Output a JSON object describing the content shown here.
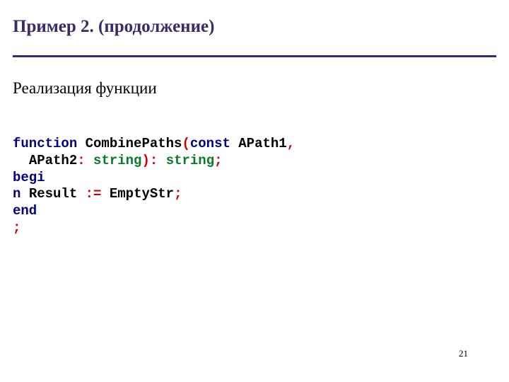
{
  "title": "Пример 2. (продолжение)",
  "subtitle": "Реализация функции",
  "code": {
    "l1": {
      "kw1": "function",
      "sp1": " ",
      "name": "CombinePaths",
      "p1": "(",
      "kw2": "const",
      "sp2": " ",
      "arg1": "APath1",
      "c1": ","
    },
    "l2": {
      "indent": "  ",
      "arg2": "APath2",
      "colon": ": ",
      "t1": "string",
      "p2": ")",
      "colon2": ": ",
      "t2": "string",
      "semi": ";"
    },
    "l3": {
      "kw": "begi"
    },
    "l4": {
      "kw": "n",
      "sp": " ",
      "res": "Result",
      "sp2": " ",
      "assign": ":=",
      "sp3": " ",
      "val": "EmptyStr",
      "semi": ";"
    },
    "l5": {
      "kw": "end"
    },
    "l6": {
      "semi": ";"
    }
  },
  "page_number": "21"
}
